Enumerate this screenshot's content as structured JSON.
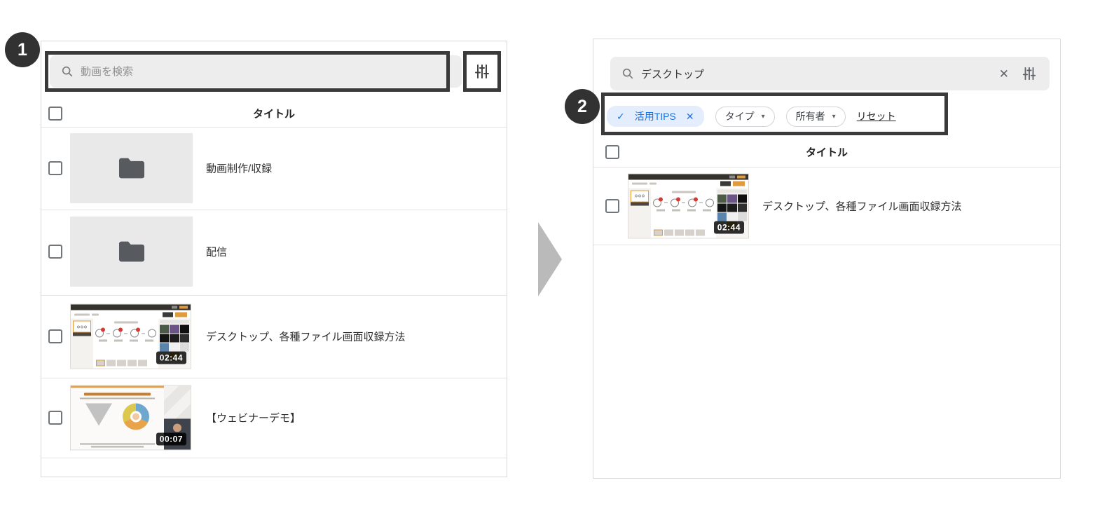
{
  "steps": {
    "badge1": "1",
    "badge2": "2"
  },
  "icons": {
    "chip_check": "✓",
    "chip_remove": "✕",
    "clear": "✕",
    "dropdown_caret": "▾"
  },
  "left_panel": {
    "search": {
      "placeholder": "動画を検索"
    },
    "table": {
      "header": "タイトル"
    },
    "rows": [
      {
        "type": "folder",
        "title": "動画制作/収録"
      },
      {
        "type": "folder",
        "title": "配信"
      },
      {
        "type": "video",
        "title": "デスクトップ、各種ファイル画面収録方法",
        "duration": "02:44"
      },
      {
        "type": "video",
        "title": "【ウェビナーデモ】",
        "duration": "00:07"
      }
    ]
  },
  "right_panel": {
    "search": {
      "value": "デスクトップ"
    },
    "filters": {
      "active_chip": {
        "label": "活用TIPS"
      },
      "dropdowns": [
        {
          "label": "タイプ"
        },
        {
          "label": "所有者"
        }
      ],
      "reset_label": "リセット"
    },
    "table": {
      "header": "タイトル"
    },
    "rows": [
      {
        "type": "video",
        "title": "デスクトップ、各種ファイル画面収録方法",
        "duration": "02:44"
      }
    ]
  },
  "colors": {
    "highlight_border": "#3a3a3a",
    "chip_bg": "#e3edfc",
    "chip_fg": "#1a73e8",
    "duration_bg": "#000000",
    "badge_bg": "#323232"
  }
}
